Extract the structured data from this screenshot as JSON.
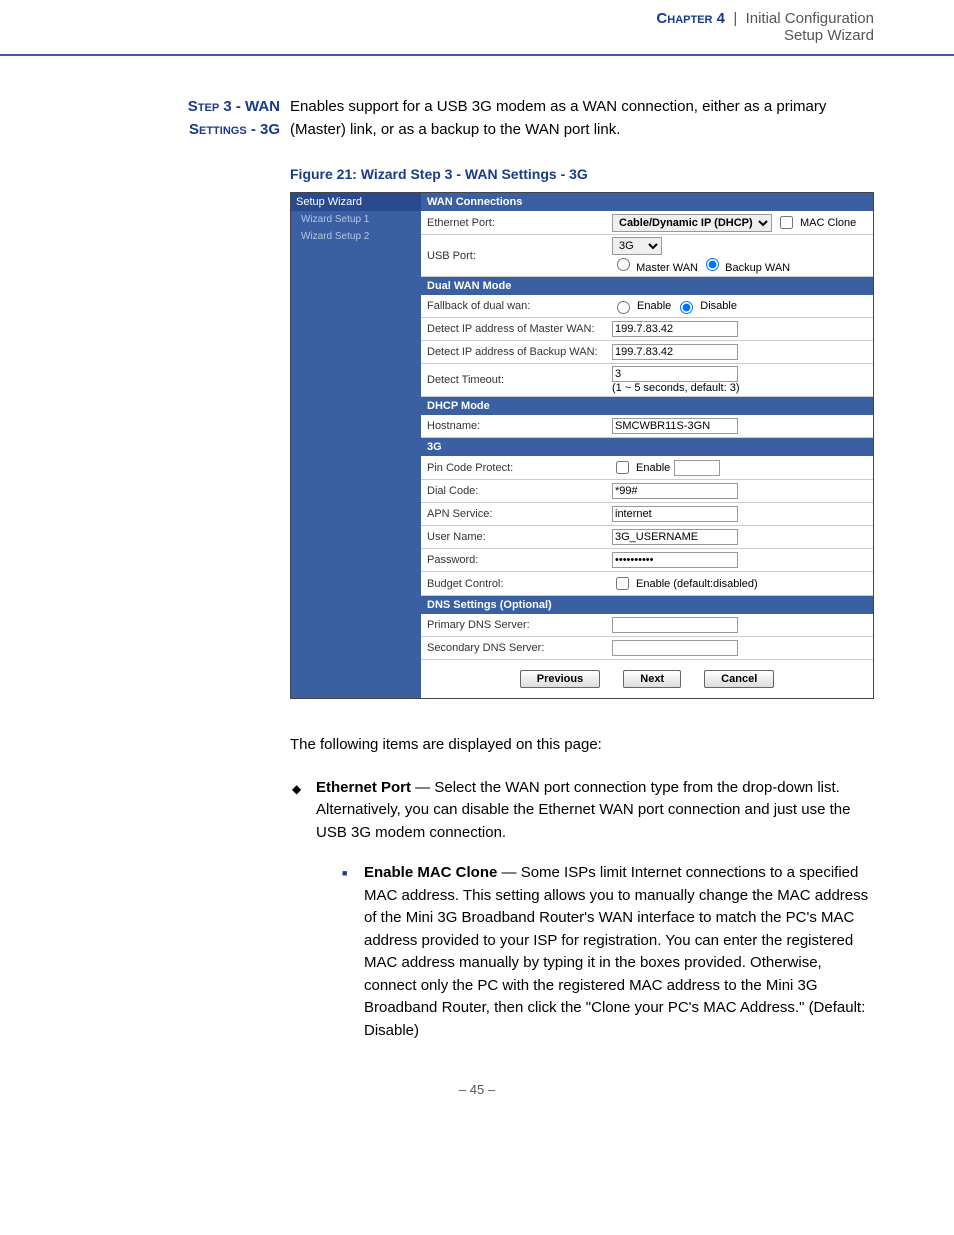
{
  "header": {
    "chapter": "Chapter 4",
    "sep": "|",
    "title": "Initial Configuration",
    "subtitle": "Setup Wizard"
  },
  "step": {
    "line1": "Step 3 - WAN",
    "line2": "Settings - 3G",
    "text": "Enables support for a USB 3G modem as a WAN connection, either as a primary (Master) link, or as a backup to the WAN port link."
  },
  "figure_caption": "Figure 21:  Wizard Step 3 - WAN Settings - 3G",
  "screenshot": {
    "sidebar": {
      "root": "Setup Wizard",
      "items": [
        "Wizard Setup 1",
        "Wizard Setup 2"
      ]
    },
    "sections": {
      "wan_conn": "WAN Connections",
      "dual_wan": "Dual WAN Mode",
      "dhcp": "DHCP Mode",
      "g3": "3G",
      "dns": "DNS Settings (Optional)"
    },
    "rows": {
      "eth_port": {
        "label": "Ethernet Port:",
        "select": "Cable/Dynamic IP (DHCP)",
        "mac_clone": "MAC Clone"
      },
      "usb_port": {
        "label": "USB Port:",
        "select": "3G",
        "r1": "Master WAN",
        "r2": "Backup WAN"
      },
      "fallback": {
        "label": "Fallback of dual wan:",
        "r1": "Enable",
        "r2": "Disable"
      },
      "detect_master": {
        "label": "Detect IP address of Master WAN:",
        "value": "199.7.83.42"
      },
      "detect_backup": {
        "label": "Detect IP address of Backup WAN:",
        "value": "199.7.83.42"
      },
      "detect_timeout": {
        "label": "Detect Timeout:",
        "value": "3",
        "hint": "(1 ~ 5 seconds, default: 3)"
      },
      "hostname": {
        "label": "Hostname:",
        "value": "SMCWBR11S-3GN"
      },
      "pin": {
        "label": "Pin Code Protect:",
        "cb": "Enable"
      },
      "dial": {
        "label": "Dial Code:",
        "value": "*99#"
      },
      "apn": {
        "label": "APN Service:",
        "value": "internet"
      },
      "user": {
        "label": "User Name:",
        "value": "3G_USERNAME"
      },
      "pass": {
        "label": "Password:",
        "value": "••••••••••"
      },
      "budget": {
        "label": "Budget Control:",
        "cb": "Enable (default:disabled)"
      },
      "pdns": {
        "label": "Primary DNS Server:",
        "value": ""
      },
      "sdns": {
        "label": "Secondary DNS Server:",
        "value": ""
      }
    },
    "buttons": {
      "prev": "Previous",
      "next": "Next",
      "cancel": "Cancel"
    }
  },
  "body_text": "The following items are displayed on this page:",
  "bullet1": {
    "lead": "Ethernet Port",
    "text": " — Select the WAN port connection type from the drop-down list. Alternatively, you can disable the Ethernet WAN port connection and just use the USB 3G modem connection."
  },
  "bullet2": {
    "lead": "Enable MAC Clone",
    "text": " — Some ISPs limit Internet connections to a specified MAC address. This setting allows you to manually change the MAC address of the Mini 3G Broadband Router's WAN interface to match the PC's MAC address provided to your ISP for registration. You can enter the registered MAC address manually by typing it in the boxes provided. Otherwise, connect only the PC with the registered MAC address to the Mini 3G Broadband Router, then click the \"Clone your PC's MAC Address.\" (Default: Disable)"
  },
  "page_num": "–  45  –"
}
